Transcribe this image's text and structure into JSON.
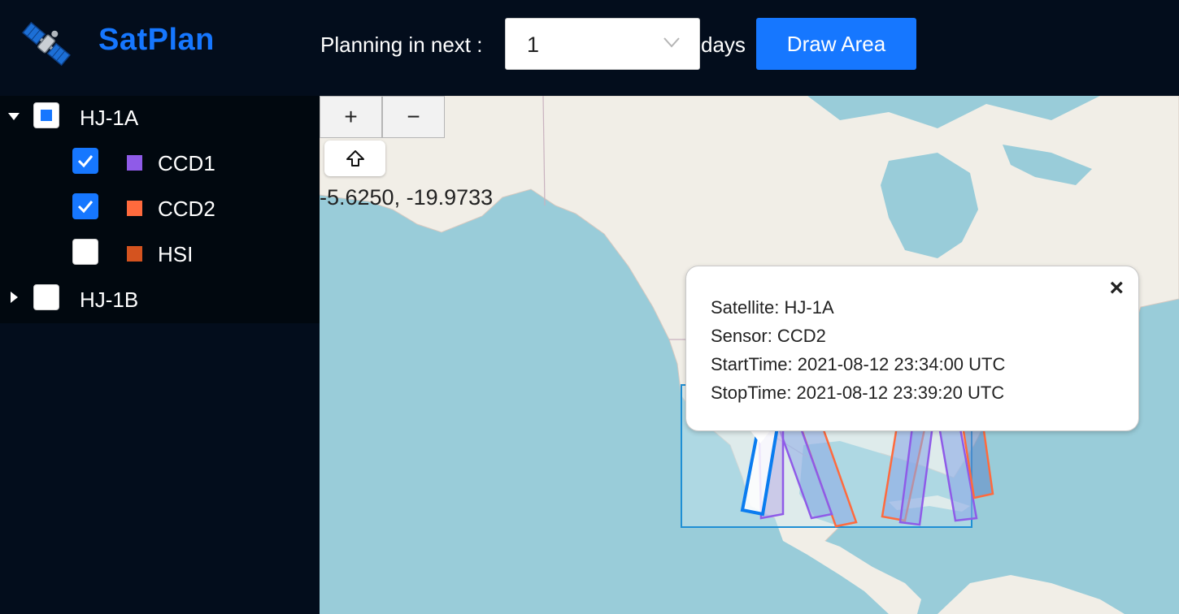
{
  "header": {
    "app_title": "SatPlan",
    "logo_icon": "satellite-icon",
    "planning_label": "Planning in next :",
    "days_value": "1",
    "days_unit": "days",
    "draw_button": "Draw Area"
  },
  "tree": [
    {
      "label": "HJ-1A",
      "expanded": true,
      "state": "partial"
    },
    {
      "label": "CCD1",
      "checked": true,
      "color": "#8f5be8"
    },
    {
      "label": "CCD2",
      "checked": true,
      "color": "#ff6a3d"
    },
    {
      "label": "HSI",
      "checked": false,
      "color": "#d4531f"
    },
    {
      "label": "HJ-1B",
      "expanded": false,
      "state": "unchecked"
    }
  ],
  "map": {
    "zoom_in": "+",
    "zoom_out": "−",
    "home_icon": "home-arrow-icon",
    "coordinates": "-5.6250, -19.9733"
  },
  "popup": {
    "close": "×",
    "satellite": "Satellite: HJ-1A",
    "sensor": "Sensor: CCD2",
    "start": "StartTime: 2021-08-12 23:34:00 UTC",
    "stop": "StopTime: 2021-08-12 23:39:20 UTC"
  }
}
